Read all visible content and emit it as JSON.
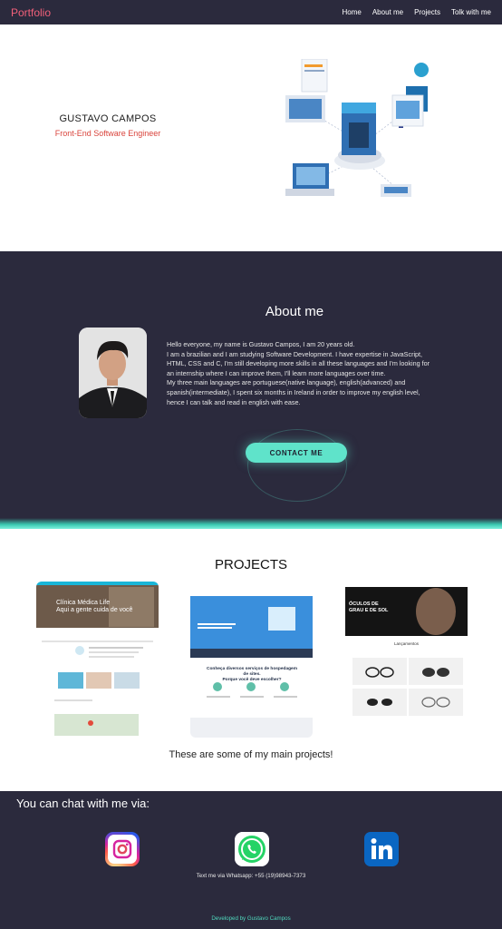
{
  "nav": {
    "logo": "Portfolio",
    "links": [
      "Home",
      "About me",
      "Projects",
      "Tolk with me"
    ]
  },
  "hero": {
    "name": "GUSTAVO CAMPOS",
    "role": "Front-End Software Engineer"
  },
  "about": {
    "title": "About me",
    "paragraphs": [
      "Hello everyone, my name is Gustavo Campos, I am 20 years old.",
      "I am a brazilian and I am studying Software Development. I have expertise in JavaScript, HTML, CSS and C, I'm still developing more skills in all these languages and I'm looking for an internship where I can improve them, I'll learn more languages over time.",
      "My three main languages are portuguese(native language), english(advanced) and spanish(intermediate), I spent six months in Ireland in order to improve my english level, hence I can talk and read in english with ease."
    ],
    "contact_button": "CONTACT ME"
  },
  "projects": {
    "title": "PROJECTS",
    "caption": "These are some of my main projects!",
    "cards": [
      {
        "headline": "Clínica Médica Life",
        "sub": "Aqui a gente cuida de você"
      },
      {
        "headline": "Conheça diversos serviços de hospedagem de sites.",
        "sub": "Porque você deve escolher?"
      },
      {
        "headline": "ÓCULOS DE GRAU E DE SOL",
        "sub": "Lançamentos"
      }
    ]
  },
  "contact": {
    "title": "You can chat with me via:",
    "whatsapp_text": "Text me via Whatsapp: +55 (19)98943-7373",
    "credit": "Developed by Gustavo Campos",
    "icons": [
      "instagram-icon",
      "whatsapp-icon",
      "linkedin-icon"
    ]
  },
  "colors": {
    "dark": "#2b2a3d",
    "accent": "#5fe3ca",
    "logo": "#f2607a",
    "role": "#d9443c"
  }
}
